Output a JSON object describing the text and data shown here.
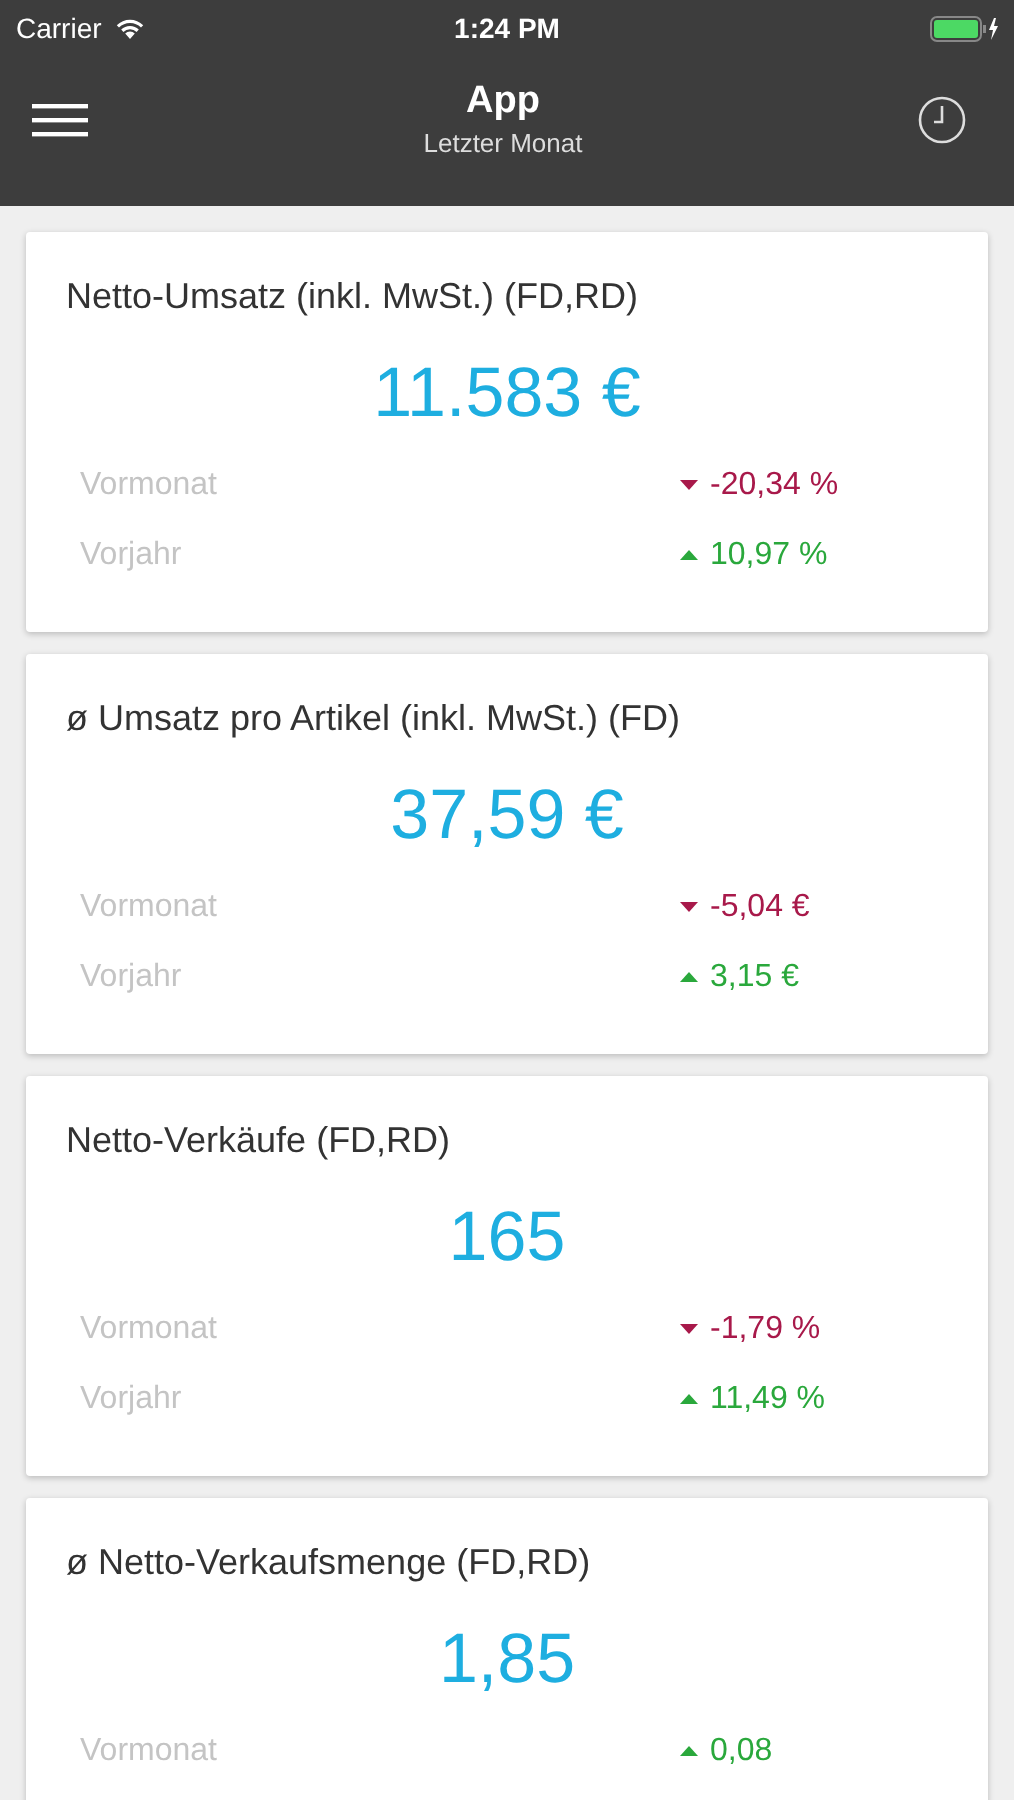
{
  "status_bar": {
    "carrier": "Carrier",
    "time": "1:24 PM"
  },
  "header": {
    "title": "App",
    "subtitle": "Letzter Monat"
  },
  "cards": [
    {
      "title": "Netto-Umsatz (inkl. MwSt.) (FD,RD)",
      "value": "11.583 €",
      "rows": [
        {
          "label": "Vormonat",
          "kind": "down",
          "delta": "-20,34 %"
        },
        {
          "label": "Vorjahr",
          "kind": "up",
          "delta": "10,97 %"
        }
      ]
    },
    {
      "title": "ø Umsatz pro Artikel (inkl. MwSt.) (FD)",
      "value": "37,59 €",
      "rows": [
        {
          "label": "Vormonat",
          "kind": "down",
          "delta": "-5,04 €"
        },
        {
          "label": "Vorjahr",
          "kind": "up",
          "delta": "3,15 €"
        }
      ]
    },
    {
      "title": "Netto-Verkäufe (FD,RD)",
      "value": "165",
      "rows": [
        {
          "label": "Vormonat",
          "kind": "down",
          "delta": "-1,79 %"
        },
        {
          "label": "Vorjahr",
          "kind": "up",
          "delta": "11,49 %"
        }
      ]
    },
    {
      "title": "ø Netto-Verkaufsmenge (FD,RD)",
      "value": "1,85",
      "rows": [
        {
          "label": "Vormonat",
          "kind": "up",
          "delta": "0,08"
        }
      ]
    }
  ]
}
